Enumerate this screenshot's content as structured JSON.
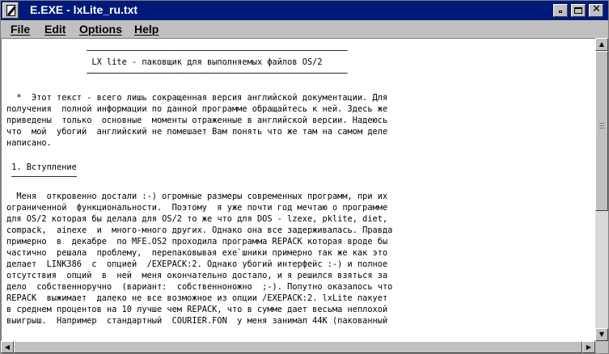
{
  "window": {
    "title": "E.EXE - lxLite_ru.txt"
  },
  "menu": [
    {
      "id": "file",
      "label": "File"
    },
    {
      "id": "edit",
      "label": "Edit"
    },
    {
      "id": "options",
      "label": "Options"
    },
    {
      "id": "help",
      "label": "Help"
    }
  ],
  "document": {
    "lines": [
      "                ────────────────────────────────────────────────────",
      "                 LX lite - паковщик для выполняемых файлов OS/2",
      "                ────────────────────────────────────────────────────",
      "",
      "",
      "  *  Этот текст - всего лишь сокращенная версия английской документации. Для",
      "получения  полной информации по данной программе обращайтесь к ней. Здесь же",
      "приведены  только  основные  моменты отраженные в английской версии. Надеюсь",
      "что  мой  убогий  английский не помешает Вам понять что же там на самом деле",
      "написано.",
      "",
      " 1. Вступление",
      " ─────────────",
      "  Меня  откровенно достали :-) огромные размеры современных программ, при их",
      "ограниченной  функциональности.  Поэтому  я уже почти год мечтаю о программе",
      "для OS/2 которая бы делала для OS/2 то же что для DOS - lzexe, pklite, diet,",
      "compack,  ainexe  и  много-много других. Однако она все задерживалась. Правда",
      "примерно  в  декабре  по MFE.OS2 проходила программа REPACK которая вроде бы",
      "частично  решала  проблему,  перепаковывая exe`шники примерно так же как это",
      "делает  LINK386  с  опцией  /EXEPACK:2. Однако убогий интерфейс :-) и полное",
      "отсутствия  опций  в  ней  меня окончательно достало, и я решился взяться за",
      "дело  собственноручно  (вариант:  собственноножно  ;-). Попутно оказалось что",
      "REPACK  выжимает  далеко не все возможное из опции /EXEPACK:2. lxLite пакует",
      "в среднем процентов на 10 лучше чем REPACK, что в сумме дает весьма неплохой",
      "выигрыш.  Например  стандартный  COURIER.FON  у меня занимал 44K (пакованный"
    ]
  }
}
